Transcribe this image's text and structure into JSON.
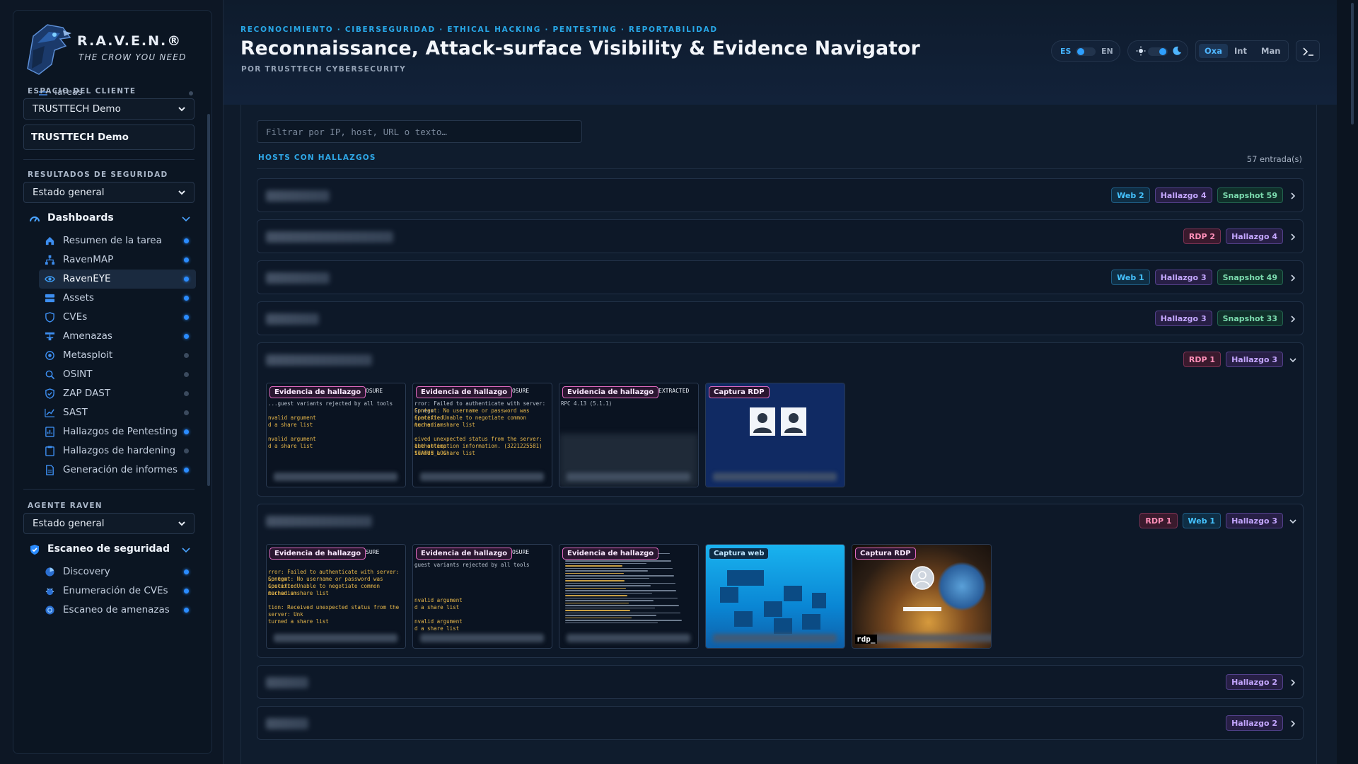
{
  "brand": {
    "name": "R.A.V.E.N.®",
    "tagline": "THE CROW YOU NEED"
  },
  "sidebar": {
    "clipped_item": "Tareas",
    "client_space": {
      "title": "ESPACIO DEL CLIENTE",
      "selected": "TRUSTTECH Demo",
      "input_value": "TRUSTTECH Demo"
    },
    "security_results": {
      "title": "RESULTADOS DE SEGURIDAD",
      "selected": "Estado general"
    },
    "dashboards": {
      "label": "Dashboards",
      "items": [
        {
          "label": "Resumen de la tarea",
          "icon": "home-icon",
          "status": "on"
        },
        {
          "label": "RavenMAP",
          "icon": "sitemap-icon",
          "status": "on"
        },
        {
          "label": "RavenEYE",
          "icon": "eye-icon",
          "status": "on",
          "active": true
        },
        {
          "label": "Assets",
          "icon": "server-icon",
          "status": "on"
        },
        {
          "label": "CVEs",
          "icon": "shield-icon",
          "status": "on"
        },
        {
          "label": "Amenazas",
          "icon": "network-icon",
          "status": "on"
        },
        {
          "label": "Metasploit",
          "icon": "target-icon",
          "status": "off"
        },
        {
          "label": "OSINT",
          "icon": "search-icon",
          "status": "off"
        },
        {
          "label": "ZAP DAST",
          "icon": "shield-check-icon",
          "status": "off"
        },
        {
          "label": "SAST",
          "icon": "chart-line-icon",
          "status": "off"
        },
        {
          "label": "Hallazgos de Pentesting",
          "icon": "report-icon",
          "status": "on"
        },
        {
          "label": "Hallazgos de hardening",
          "icon": "clipboard-icon",
          "status": "off"
        },
        {
          "label": "Generación de informes",
          "icon": "document-icon",
          "status": "on"
        }
      ]
    },
    "agent": {
      "title": "AGENTE RAVEN",
      "selected": "Estado general"
    },
    "security_scan": {
      "label": "Escaneo de seguridad",
      "items": [
        {
          "label": "Discovery",
          "icon": "radar-icon",
          "status": "on"
        },
        {
          "label": "Enumeración de CVEs",
          "icon": "bug-icon",
          "status": "on"
        },
        {
          "label": "Escaneo de amenazas",
          "icon": "crosshair-icon",
          "status": "on"
        }
      ]
    }
  },
  "header": {
    "kicker": "RECONOCIMIENTO · CIBERSEGURIDAD · ETHICAL HACKING · PENTESTING · REPORTABILIDAD",
    "title": "Reconnaissance, Attack-surface Visibility & Evidence Navigator",
    "subtitle": "POR TRUSTTECH CYBERSECURITY",
    "lang": {
      "es": "ES",
      "en": "EN"
    },
    "modes": [
      "Oxa",
      "Int",
      "Man"
    ],
    "active_mode": "Oxa",
    "terminal_label": ">_"
  },
  "main": {
    "filter_placeholder": "Filtrar por IP, host, URL o texto…",
    "hosts_title": "HOSTS CON HALLAZGOS",
    "entries_count": "57 entrada(s)",
    "hosts": [
      {
        "badges": [
          {
            "type": "web",
            "label": "Web 2"
          },
          {
            "type": "hall",
            "label": "Hallazgo 4"
          },
          {
            "type": "snap",
            "label": "Snapshot 59"
          }
        ],
        "expanded": false
      },
      {
        "badges": [
          {
            "type": "rdp",
            "label": "RDP 2"
          },
          {
            "type": "hall",
            "label": "Hallazgo 4"
          }
        ],
        "expanded": false
      },
      {
        "badges": [
          {
            "type": "web",
            "label": "Web 1"
          },
          {
            "type": "hall",
            "label": "Hallazgo 3"
          },
          {
            "type": "snap",
            "label": "Snapshot 49"
          }
        ],
        "expanded": false
      },
      {
        "badges": [
          {
            "type": "hall",
            "label": "Hallazgo 3"
          },
          {
            "type": "snap",
            "label": "Snapshot 33"
          }
        ],
        "expanded": false
      },
      {
        "badges": [
          {
            "type": "rdp",
            "label": "RDP 1"
          },
          {
            "type": "hall",
            "label": "Hallazgo 3"
          }
        ],
        "expanded": true,
        "evidence": [
          {
            "kind": "finding",
            "label": "Evidencia de hallazgo",
            "header": "OSURE",
            "lines": [
              "...guest variants rejected by all tools",
              "",
              "nvalid argument",
              "d a share list",
              "",
              "nvalid argument",
              "d a share list"
            ]
          },
          {
            "kind": "finding",
            "label": "Evidencia de hallazgo",
            "header": "OSURE",
            "lines": [
              "rror: Failed to authenticate with server: Spnego",
              "Context: No username or password was specified",
              "Context: Unable to negotiate common mechanism",
              "turned a share list",
              "",
              "eived unexpected status from the server: the attemp",
              "authentication information. (3221225581) STATUS_LOG",
              "turned a share list"
            ]
          },
          {
            "kind": "finding",
            "label": "Evidencia de hallazgo",
            "header": "EXTRACTED",
            "lines": [
              "RPC 4.13 (5.1.1)"
            ]
          },
          {
            "kind": "rdp",
            "label": "Captura RDP"
          }
        ]
      },
      {
        "badges": [
          {
            "type": "rdp",
            "label": "RDP 1"
          },
          {
            "type": "web",
            "label": "Web 1"
          },
          {
            "type": "hall",
            "label": "Hallazgo 3"
          }
        ],
        "expanded": true,
        "evidence": [
          {
            "kind": "finding",
            "label": "Evidencia de hallazgo",
            "header": "SURE",
            "lines": [
              "",
              "rror: Failed to authenticate with server: Spnego",
              "Context: No username or password was specified",
              "Context: Unable to negotiate common mechanism",
              "turned a share list",
              "",
              "tion: Received unexpected status from the server: Unk",
              "",
              "turned a share list"
            ]
          },
          {
            "kind": "finding",
            "label": "Evidencia de hallazgo",
            "header": "OSURE",
            "lines": [
              "guest variants rejected by all tools",
              "",
              "",
              "",
              "",
              "nvalid argument",
              "d a share list",
              "",
              "nvalid argument",
              "d a share list"
            ]
          },
          {
            "kind": "finding-dense",
            "label": "Evidencia de hallazgo"
          },
          {
            "kind": "web",
            "label": "Captura web"
          },
          {
            "kind": "rdp-login",
            "label": "Captura RDP",
            "tag": "rdp_"
          }
        ]
      },
      {
        "badges": [
          {
            "type": "hall",
            "label": "Hallazgo 2"
          }
        ],
        "expanded": false
      },
      {
        "badges": [
          {
            "type": "hall",
            "label": "Hallazgo 2"
          }
        ],
        "expanded": false
      }
    ]
  },
  "colors": {
    "accent": "#2ea0ff",
    "kicker": "#28a8e8",
    "bg": "#0f1b2b"
  }
}
